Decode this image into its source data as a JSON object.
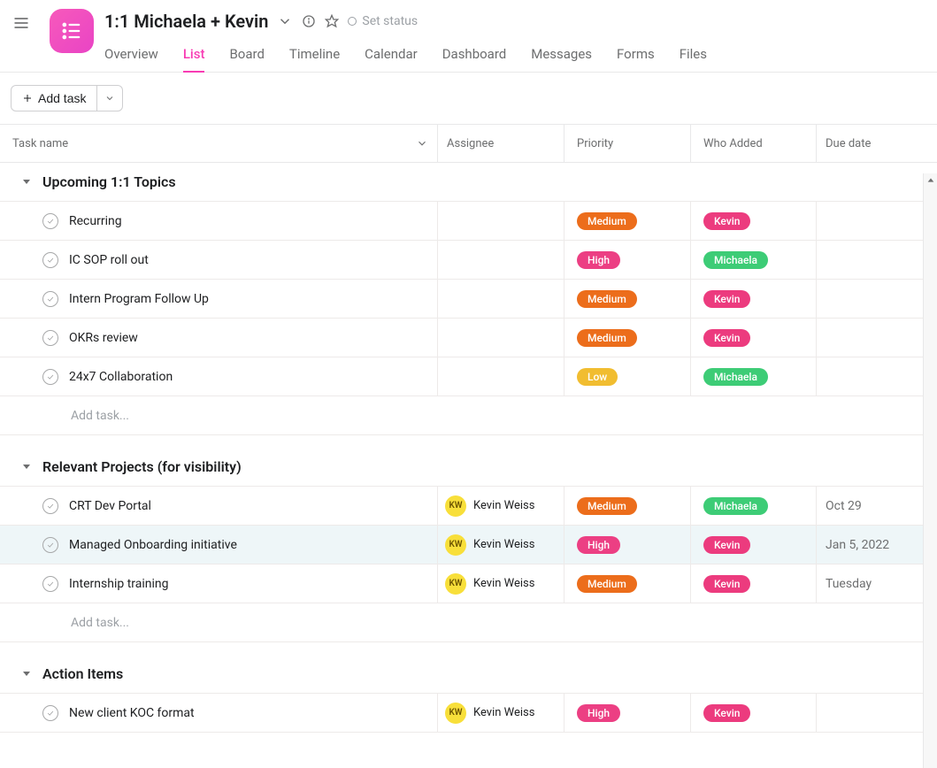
{
  "header": {
    "title": "1:1 Michaela + Kevin",
    "set_status": "Set status"
  },
  "tabs": [
    "Overview",
    "List",
    "Board",
    "Timeline",
    "Calendar",
    "Dashboard",
    "Messages",
    "Forms",
    "Files"
  ],
  "active_tab": 1,
  "toolbar": {
    "add_task": "Add task"
  },
  "columns": {
    "task": "Task name",
    "assignee": "Assignee",
    "priority": "Priority",
    "who": "Who Added",
    "due": "Due date"
  },
  "add_task_placeholder": "Add task...",
  "priority_colors": {
    "High": "pink",
    "Medium": "orange",
    "Low": "yellow"
  },
  "who_colors": {
    "Kevin": "rose",
    "Michaela": "green"
  },
  "sections": [
    {
      "name": "Upcoming 1:1 Topics",
      "tasks": [
        {
          "title": "Recurring",
          "assignee": null,
          "priority": "Medium",
          "who": "Kevin",
          "due": ""
        },
        {
          "title": "IC SOP roll out",
          "assignee": null,
          "priority": "High",
          "who": "Michaela",
          "due": ""
        },
        {
          "title": "Intern Program Follow Up",
          "assignee": null,
          "priority": "Medium",
          "who": "Kevin",
          "due": ""
        },
        {
          "title": "OKRs review",
          "assignee": null,
          "priority": "Medium",
          "who": "Kevin",
          "due": ""
        },
        {
          "title": "24x7 Collaboration",
          "assignee": null,
          "priority": "Low",
          "who": "Michaela",
          "due": ""
        }
      ],
      "show_add": true
    },
    {
      "name": "Relevant Projects (for visibility)",
      "tasks": [
        {
          "title": "CRT Dev Portal",
          "assignee": {
            "initials": "KW",
            "name": "Kevin Weiss"
          },
          "priority": "Medium",
          "who": "Michaela",
          "due": "Oct 29"
        },
        {
          "title": "Managed Onboarding initiative",
          "assignee": {
            "initials": "KW",
            "name": "Kevin Weiss"
          },
          "priority": "High",
          "who": "Kevin",
          "due": "Jan 5, 2022",
          "hover": true
        },
        {
          "title": "Internship training",
          "assignee": {
            "initials": "KW",
            "name": "Kevin Weiss"
          },
          "priority": "Medium",
          "who": "Kevin",
          "due": "Tuesday"
        }
      ],
      "show_add": true
    },
    {
      "name": "Action Items",
      "tasks": [
        {
          "title": "New client KOC format",
          "assignee": {
            "initials": "KW",
            "name": "Kevin Weiss"
          },
          "priority": "High",
          "who": "Kevin",
          "due": ""
        }
      ],
      "show_add": false
    }
  ]
}
